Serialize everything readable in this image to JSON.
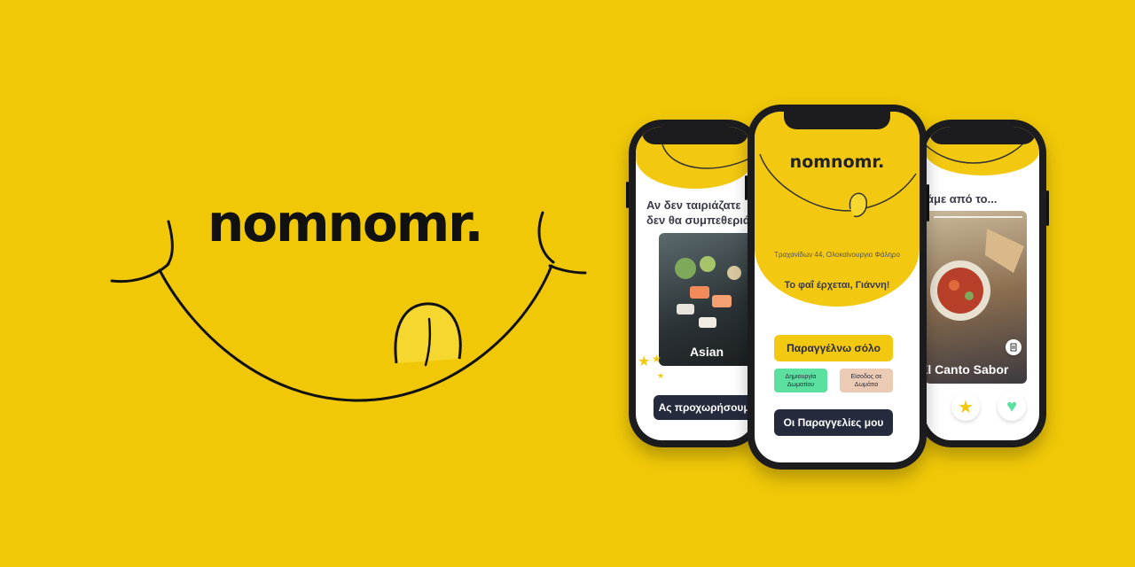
{
  "brand": {
    "logo": "nomnomr."
  },
  "phone_left": {
    "heading_line1": "Αν δεν ταιριάζατε",
    "heading_line2": "δεν θα συμπεθεριά",
    "card_label": "Asian",
    "button_label": "Ας προχωρήσουμε"
  },
  "phone_center": {
    "logo": "nomnomr.",
    "address": "Τραχανίδων 44, Ολοκαίνουργιο Φάληρο",
    "greeting": "Το φαΐ έρχεται, Γιάννη!",
    "solo_button": "Παραγγέλνω σόλο",
    "create_room_button": "Δημιουργία Δωματίου",
    "join_room_button": "Είσοδος σε Δωμάτιο",
    "my_orders_button": "Οι Παραγγελίες μου"
  },
  "phone_right": {
    "heading": "άμε από το...",
    "card_label": "El Canto Sabor"
  },
  "colors": {
    "background": "#f0c808",
    "accent_yellow": "#f2c811",
    "dark": "#262a3d",
    "green": "#5be0a0",
    "peach": "#eccbb4"
  }
}
